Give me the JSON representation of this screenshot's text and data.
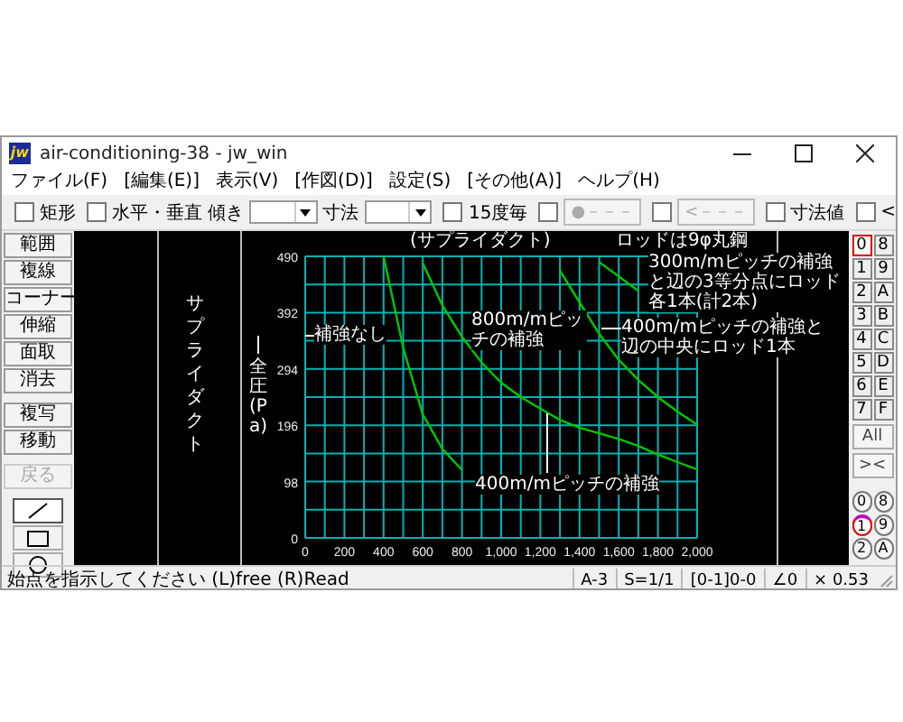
{
  "window": {
    "logo_text": "jw",
    "title": "air-conditioning-38 - jw_win"
  },
  "menu": [
    "ファイル(F)",
    "[編集(E)]",
    "表示(V)",
    "[作図(D)]",
    "設定(S)",
    "[その他(A)]",
    "ヘルプ(H)"
  ],
  "toolbar": [
    {
      "kind": "checkbox",
      "label": "矩形",
      "checked": false
    },
    {
      "kind": "checkbox",
      "label": "水平・垂直",
      "checked": false
    },
    {
      "kind": "combo",
      "label": "傾き"
    },
    {
      "kind": "combo",
      "label": "寸法"
    },
    {
      "kind": "checkbox",
      "label": "15度毎",
      "checked": false
    },
    {
      "kind": "checkbox",
      "checked": false
    },
    {
      "kind": "button",
      "label": "●－－－",
      "disabled": true
    },
    {
      "kind": "checkbox",
      "checked": false
    },
    {
      "kind": "button",
      "label": "<－－－",
      "disabled": true
    },
    {
      "kind": "checkbox",
      "label": "寸法値",
      "checked": false
    },
    {
      "kind": "checkbox",
      "label": "<",
      "checked": false
    }
  ],
  "left_tools": [
    {
      "label": "範囲",
      "disabled": false
    },
    {
      "label": "複線",
      "disabled": false
    },
    {
      "label": "コーナー",
      "disabled": false
    },
    {
      "label": "伸縮",
      "disabled": false
    },
    {
      "label": "面取",
      "disabled": false
    },
    {
      "label": "消去",
      "disabled": false
    },
    {
      "label": "複写",
      "disabled": false
    },
    {
      "label": "移動",
      "disabled": false
    },
    {
      "label": "戻る",
      "disabled": true
    }
  ],
  "draw_tools": [
    {
      "kind": "line",
      "selected": true
    },
    {
      "kind": "rect",
      "selected": false
    },
    {
      "kind": "circle",
      "selected": false
    }
  ],
  "canvas": {
    "side_label": "サプライダクト",
    "chart_data": {
      "type": "line",
      "title": "(サプライダクト)",
      "ylabel": "全圧(Pa)",
      "x": [
        400,
        500,
        600,
        700,
        800,
        900,
        1000,
        1100,
        1200,
        1300,
        1400,
        1500,
        1600,
        1700,
        1800,
        1900,
        2000
      ],
      "grid": true,
      "xlim": [
        0,
        2000
      ],
      "ylim": [
        0,
        490
      ],
      "xticks": [
        0,
        200,
        400,
        600,
        800,
        {
          "value": 1000,
          "label": "1,000"
        },
        {
          "value": 1200,
          "label": "1,200"
        },
        {
          "value": 1400,
          "label": "1,400"
        },
        {
          "value": 1600,
          "label": "1,600"
        },
        {
          "value": 1800,
          "label": "1,800"
        },
        {
          "value": 2000,
          "label": "2,000"
        }
      ],
      "yticks": [
        0,
        98,
        196,
        294,
        392,
        490
      ],
      "series": [
        {
          "name": "補強なし",
          "color": "#00c800",
          "values": [
            490,
            330,
            215,
            155,
            118,
            null,
            null,
            null,
            null,
            null,
            null,
            null,
            null,
            null,
            null,
            null,
            null
          ]
        },
        {
          "name": "400m/mピッチの補強",
          "color": "#00c800",
          "values": [
            null,
            null,
            478,
            405,
            350,
            305,
            270,
            245,
            225,
            205,
            192,
            182,
            172,
            160,
            145,
            132,
            119
          ]
        },
        {
          "name": "400m/mピッチの補強と辺の中央にロッド1本",
          "color": "#00c800",
          "values": [
            null,
            null,
            null,
            null,
            null,
            null,
            null,
            null,
            null,
            465,
            410,
            355,
            310,
            275,
            245,
            220,
            197
          ]
        },
        {
          "name": "300m/mピッチの補強と辺の3等分点にロッド各1本(計2本)",
          "color": "#00c800",
          "values": [
            null,
            null,
            null,
            null,
            null,
            null,
            null,
            null,
            null,
            null,
            null,
            480,
            455,
            430,
            null,
            null,
            null
          ]
        }
      ],
      "annotations": [
        {
          "text": "800m/mピッチの補強"
        },
        {
          "text": "ロッドは9φ丸鋼"
        }
      ]
    }
  },
  "layers": [
    {
      "label": "0",
      "selected": true
    },
    {
      "label": "8",
      "selected": false
    },
    {
      "label": "1",
      "selected": false
    },
    {
      "label": "9",
      "selected": false
    },
    {
      "label": "2",
      "selected": false
    },
    {
      "label": "A",
      "selected": false
    },
    {
      "label": "3",
      "selected": false
    },
    {
      "label": "B",
      "selected": false
    },
    {
      "label": "4",
      "selected": false
    },
    {
      "label": "C",
      "selected": false
    },
    {
      "label": "5",
      "selected": false
    },
    {
      "label": "D",
      "selected": false
    },
    {
      "label": "6",
      "selected": false
    },
    {
      "label": "E",
      "selected": false
    },
    {
      "label": "7",
      "selected": false
    },
    {
      "label": "F",
      "selected": false
    }
  ],
  "layer_buttons": [
    "All",
    "><"
  ],
  "groups": [
    {
      "label": "0",
      "selected": false
    },
    {
      "label": "8",
      "selected": false
    },
    {
      "label": "1",
      "selected": true
    },
    {
      "label": "9",
      "selected": false
    },
    {
      "label": "2",
      "selected": false
    },
    {
      "label": "A",
      "selected": false
    }
  ],
  "status_bar": {
    "message": "始点を指示してください (L)free (R)Read",
    "fields": [
      "A-3",
      "S=1/1",
      "[0-1]0-0",
      "∠0",
      "× 0.53"
    ]
  }
}
